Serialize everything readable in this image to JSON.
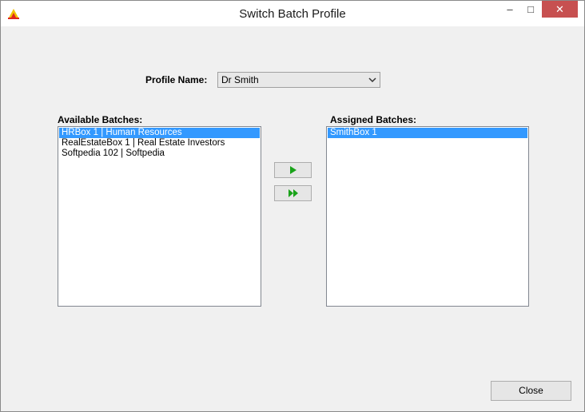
{
  "window": {
    "title": "Switch Batch Profile",
    "controls": {
      "minimize": "–",
      "maximize": "□",
      "close": "✕"
    }
  },
  "profile": {
    "label": "Profile Name:",
    "selected": "Dr Smith"
  },
  "available": {
    "label": "Available Batches:",
    "items": [
      "HRBox 1 | Human Resources",
      "RealEstateBox 1 | Real Estate Investors",
      "Softpedia 102 | Softpedia"
    ],
    "selected_index": 0
  },
  "assigned": {
    "label": "Assigned Batches:",
    "items": [
      "SmithBox 1"
    ],
    "selected_index": 0
  },
  "actions": {
    "close_label": "Close"
  },
  "colors": {
    "selection": "#3399ff",
    "arrow": "#1aa31a",
    "close_hover": "#c75050"
  },
  "icons": {
    "move_one": "play-arrow-icon",
    "move_all": "double-arrow-icon"
  }
}
